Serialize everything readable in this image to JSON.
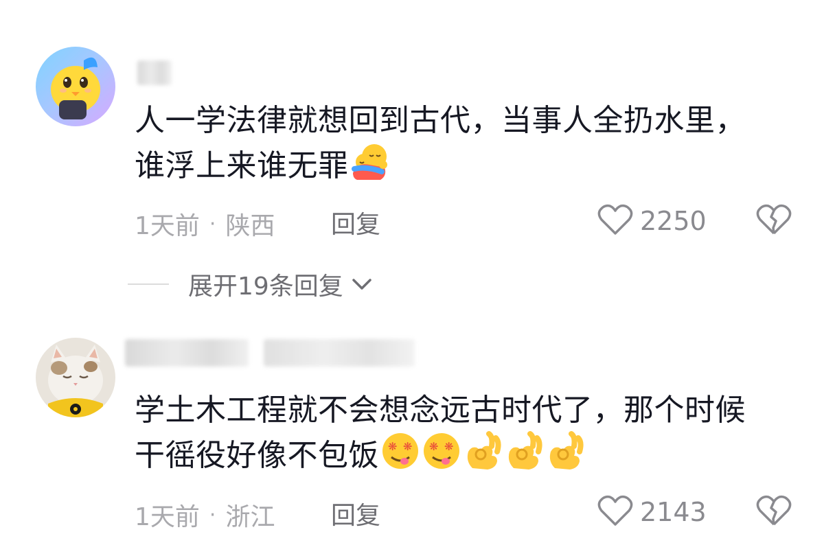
{
  "comments": [
    {
      "text_line1": "人一学法律就想回到古代，当事人全扔水里，",
      "text_line2": "谁浮上来谁无罪",
      "emojis": [
        "hug-emoji"
      ],
      "time": "1天前",
      "separator": "·",
      "location": "陕西",
      "reply_label": "回复",
      "likes": "2250"
    },
    {
      "text_line1": "学土木工程就不会想念远古时代了，那个时候",
      "text_line2": "干徭役好像不包饭",
      "emojis": [
        "drooling-face-emoji",
        "drooling-face-emoji",
        "ok-hand-emoji",
        "ok-hand-emoji",
        "ok-hand-emoji"
      ],
      "time": "1天前",
      "separator": "·",
      "location": "浙江",
      "reply_label": "回复",
      "likes": "2143"
    }
  ],
  "expand_replies": {
    "label": "展开19条回复"
  },
  "colors": {
    "text": "#161823",
    "meta": "#a9a9ad",
    "reply": "#6e6e73",
    "icon": "#8a8a8f"
  },
  "icons": {
    "like": "heart-outline-icon",
    "dislike": "broken-heart-icon",
    "expand": "chevron-down-icon"
  }
}
